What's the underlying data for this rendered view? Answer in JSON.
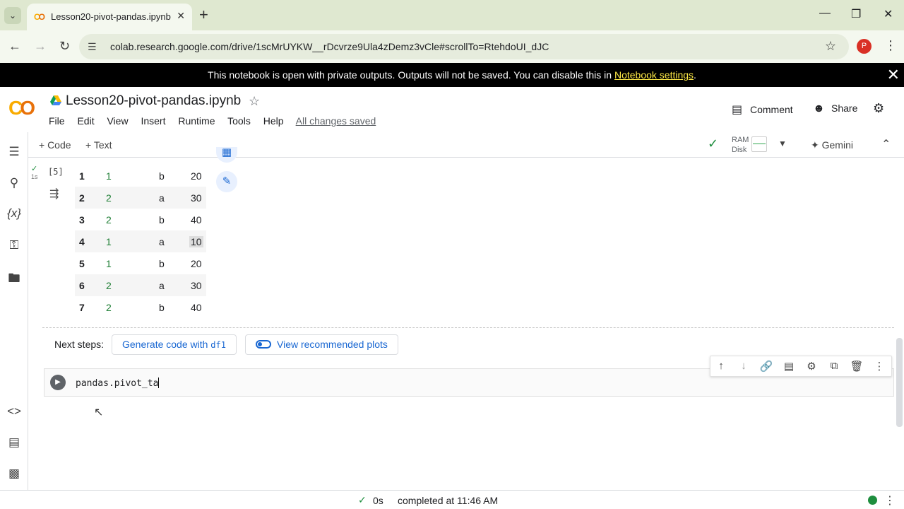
{
  "browser": {
    "tab_title": "Lesson20-pivot-pandas.ipynb -",
    "url": "colab.research.google.com/drive/1scMrUYKW__rDcvrze9Ula4zDemz3vCle#scrollTo=RtehdoUI_dJC",
    "profile_initial": "P"
  },
  "banner": {
    "text": "This notebook is open with private outputs. Outputs will not be saved. You can disable this in ",
    "link": "Notebook settings",
    "suffix": "."
  },
  "colab": {
    "logo": "CO",
    "notebook_title": "Lesson20-pivot-pandas.ipynb",
    "menu": [
      "File",
      "Edit",
      "View",
      "Insert",
      "Runtime",
      "Tools",
      "Help"
    ],
    "save_status": "All changes saved",
    "comment_label": "Comment",
    "share_label": "Share"
  },
  "toolbar": {
    "add_code": "+ Code",
    "add_text": "+ Text",
    "ram_label": "RAM",
    "disk_label": "Disk",
    "gemini_label": "Gemini"
  },
  "cell_output": {
    "exec_count": "[5]",
    "exec_time": "1s",
    "rows": [
      {
        "idx": "1",
        "a": "1",
        "b": "b",
        "v": "20"
      },
      {
        "idx": "2",
        "a": "2",
        "b": "a",
        "v": "30"
      },
      {
        "idx": "3",
        "a": "2",
        "b": "b",
        "v": "40"
      },
      {
        "idx": "4",
        "a": "1",
        "b": "a",
        "v": "10"
      },
      {
        "idx": "5",
        "a": "1",
        "b": "b",
        "v": "20"
      },
      {
        "idx": "6",
        "a": "2",
        "b": "a",
        "v": "30"
      },
      {
        "idx": "7",
        "a": "2",
        "b": "b",
        "v": "40"
      }
    ]
  },
  "next_steps": {
    "label": "Next steps:",
    "generate_prefix": "Generate code with ",
    "generate_var": "df1",
    "plots_label": "View recommended plots"
  },
  "code_cell": {
    "code": "pandas.pivot_ta"
  },
  "status": {
    "duration": "0s",
    "message": "completed at 11:46 AM"
  }
}
